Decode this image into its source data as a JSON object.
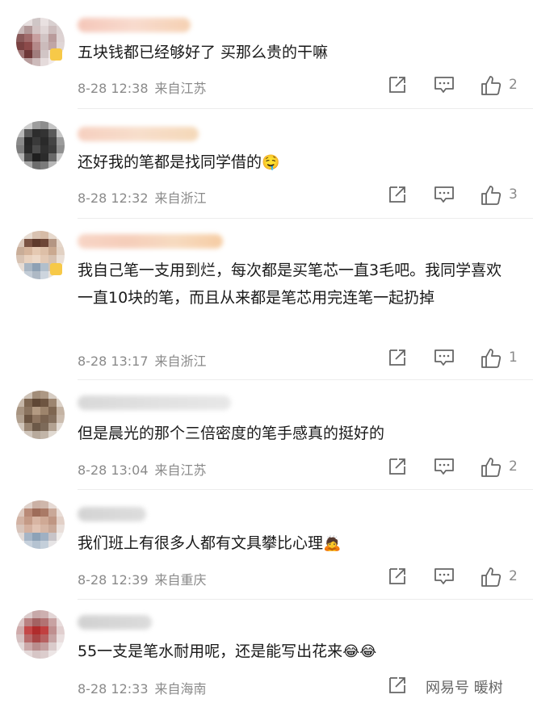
{
  "comments": [
    {
      "text": "五块钱都已经够好了 买那么贵的干嘛",
      "date": "8-28 12:38",
      "location": "来自江苏",
      "likes": "2",
      "emoji": ""
    },
    {
      "text": "还好我的笔都是找同学借的",
      "date": "8-28 12:32",
      "location": "来自浙江",
      "likes": "3",
      "emoji": "🤤"
    },
    {
      "text": "我自己笔一支用到烂，每次都是买笔芯一直3毛吧。我同学喜欢一直10块的笔，而且从来都是笔芯用完连笔一起扔掉",
      "date": "8-28 13:17",
      "location": "来自浙江",
      "likes": "1",
      "emoji": ""
    },
    {
      "text": "但是晨光的那个三倍密度的笔手感真的挺好的",
      "date": "8-28 13:04",
      "location": "来自江苏",
      "likes": "2",
      "emoji": ""
    },
    {
      "text": "我们班上有很多人都有文具攀比心理",
      "date": "8-28 12:39",
      "location": "来自重庆",
      "likes": "2",
      "emoji": "🙇"
    },
    {
      "text": "55一支是笔水耐用呢，还是能写出花来",
      "date": "8-28 12:33",
      "location": "来自海南",
      "likes": "",
      "emoji": "😂😂"
    }
  ],
  "icons": {
    "share": "share-icon",
    "comment": "comment-icon",
    "like": "like-icon"
  },
  "watermark": "网易号  暖树"
}
